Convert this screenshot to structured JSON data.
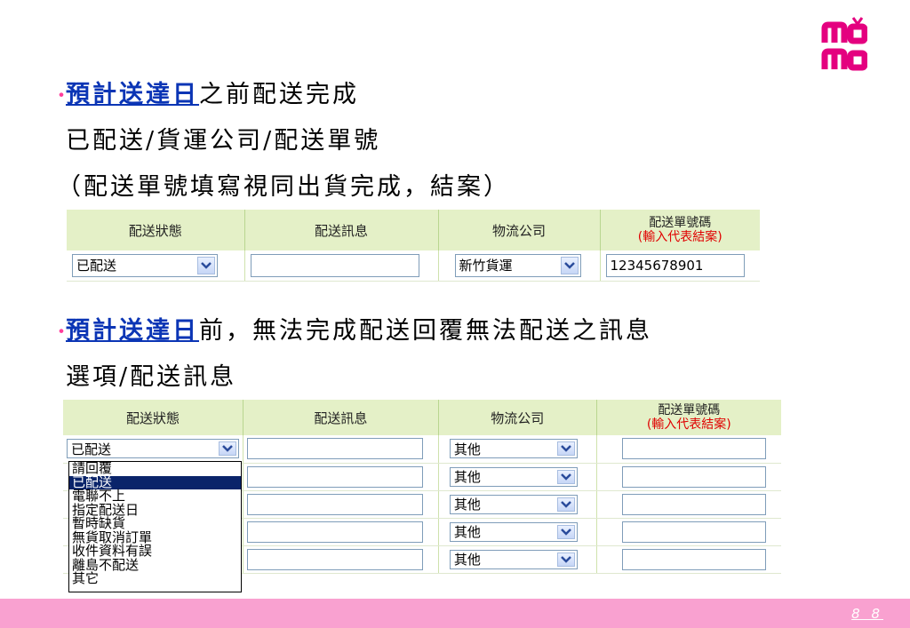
{
  "logo": {
    "text": "momo"
  },
  "section1": {
    "bullet": "・",
    "highlight": "預計送達日",
    "line1_rest": "之前配送完成",
    "line2": "已配送/貨運公司/配送單號",
    "line3": "（配送單號填寫視同出貨完成，結案）"
  },
  "table_headers": {
    "status": "配送狀態",
    "message": "配送訊息",
    "company": "物流公司",
    "tracking_top": "配送單號碼",
    "tracking_sub": "(輸入代表結案)"
  },
  "table1_row": {
    "status": "已配送",
    "message": "",
    "company": "新竹貨運",
    "tracking": "12345678901"
  },
  "section2": {
    "bullet": "・",
    "highlight": "預計送達日",
    "line1_rest": "前，無法完成配送回覆無法配送之訊息",
    "line2": "選項/配送訊息"
  },
  "table2_rows": [
    {
      "status": "已配送",
      "company": "其他"
    },
    {
      "status": "",
      "company": "其他"
    },
    {
      "status": "",
      "company": "其他"
    },
    {
      "status": "",
      "company": "其他"
    },
    {
      "status": "",
      "company": "其他"
    }
  ],
  "dropdown_options": [
    "請回覆",
    "已配送",
    "電聯不上",
    "指定配送日",
    "暫時缺貨",
    "無貨取消訂單",
    "收件資料有誤",
    "離島不配送",
    "其它"
  ],
  "dropdown_selected_index": 1,
  "footer": {
    "page": "8 8"
  },
  "colors": {
    "accent_pink": "#f9a1d0",
    "highlight_blue": "#0b35b5",
    "header_green": "#e4f0c7",
    "logo_pink": "#e4007f"
  }
}
